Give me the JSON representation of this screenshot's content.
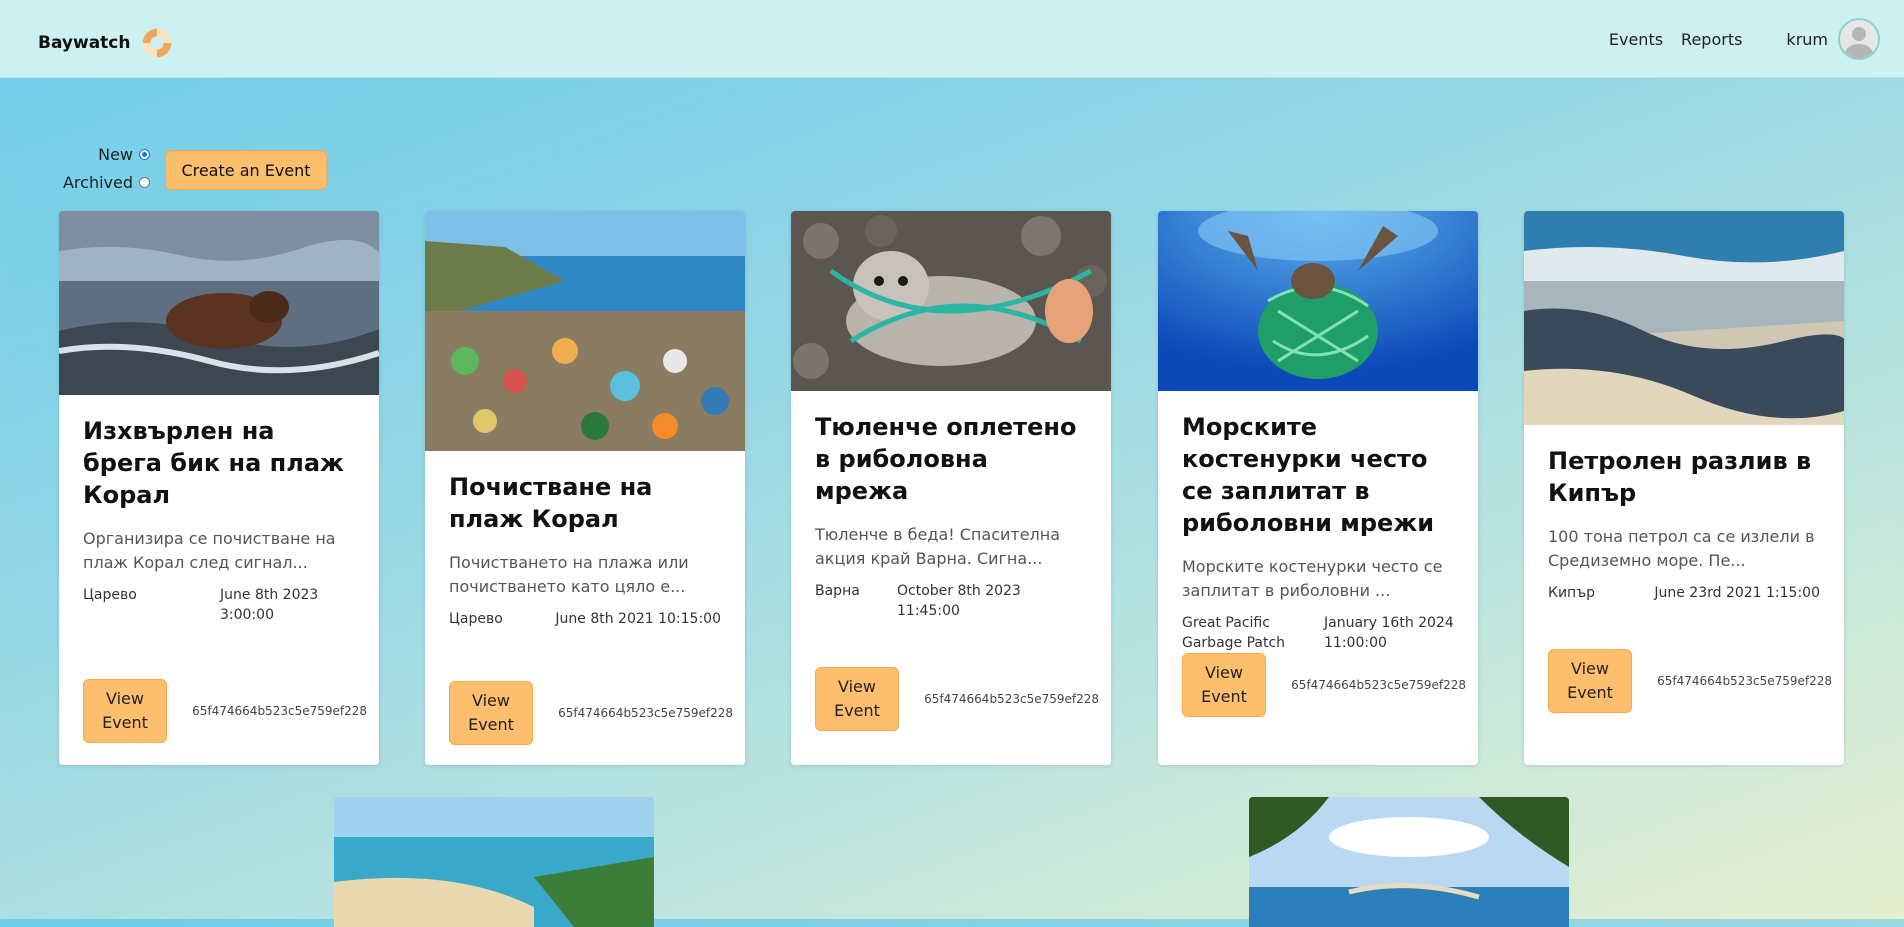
{
  "brand": {
    "name": "Baywatch",
    "logo_icon": "lifebuoy-icon"
  },
  "nav": {
    "events": "Events",
    "reports": "Reports",
    "user": "krum",
    "avatar_icon": "user-avatar-icon"
  },
  "filters": {
    "new_label": "New",
    "archived_label": "Archived",
    "selected": "New"
  },
  "create_button": "Create an Event",
  "colors": {
    "accent": "#fdbe6e",
    "topbar": "#ccf1f0"
  },
  "events": [
    {
      "title": "Изхвърлен на брега бик на плаж Корал",
      "description": "Организира се почистване на плаж Корал след сигнал...",
      "location": "Царево",
      "date": "June 8th 2023 3:00:00",
      "button": "View Event",
      "id": "65f474664b523c5e759ef228"
    },
    {
      "title": "Почистване на плаж Корал",
      "description": "Почистването на плажа или почистването като цяло е...",
      "location": "Царево",
      "date": "June 8th 2021 10:15:00",
      "button": "View Event",
      "id": "65f474664b523c5e759ef228"
    },
    {
      "title": "Тюленче оплетено в риболовна мрежа",
      "description": "Тюленче в беда! Спасителна акция край Варна. Сигна...",
      "location": "Варна",
      "date": "October 8th 2023 11:45:00",
      "button": "View Event",
      "id": "65f474664b523c5e759ef228"
    },
    {
      "title": "Морските костенурки често се заплитат в риболовни мрежи",
      "description": "Морските костенурки често се заплитат в риболовни ...",
      "location": "Great Pacific Garbage Patch",
      "date": "January 16th 2024 11:00:00",
      "button": "View Event",
      "id": "65f474664b523c5e759ef228"
    },
    {
      "title": "Петролен разлив в Кипър",
      "description": "100 тона петрол са се излели в Средиземно море. Пе...",
      "location": "Кипър",
      "date": "June 23rd 2021 1:15:00",
      "button": "View Event",
      "id": "65f474664b523c5e759ef228"
    }
  ]
}
